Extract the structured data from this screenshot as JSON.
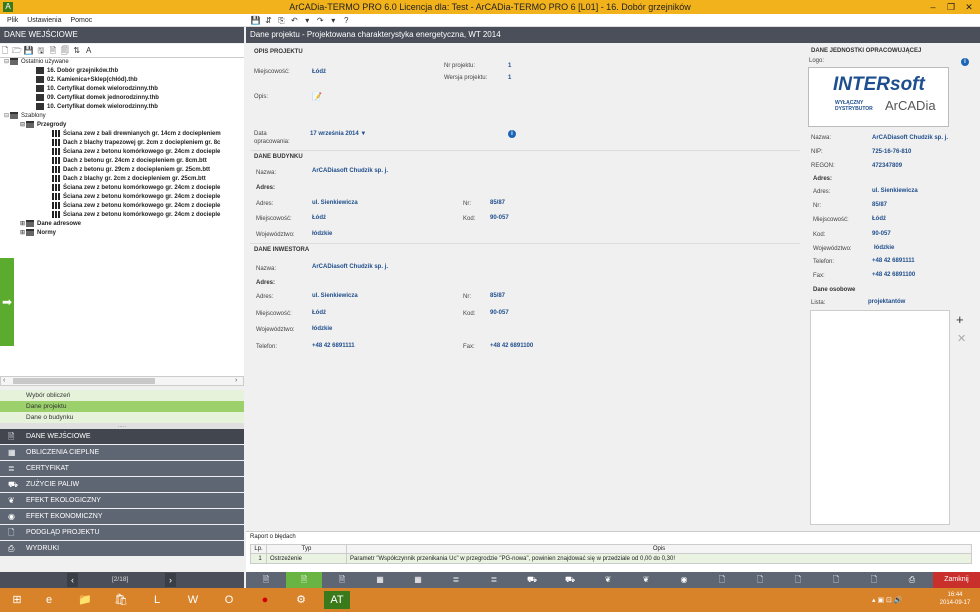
{
  "window": {
    "title": "ArCADia-TERMO PRO 6.0 Licencja dla: Test - ArCADia-TERMO PRO 6 [L01] - 16. Dobór grzejników",
    "controls": [
      "–",
      "❐",
      "✕"
    ]
  },
  "menu": [
    "Plik",
    "Ustawienia",
    "Pomoc"
  ],
  "toolbar_icons": [
    "save-icon",
    "sync-icon",
    "copy-icon",
    "undo-icon",
    "dropdown-icon",
    "redo-icon",
    "dropdown-icon",
    "help-icon"
  ],
  "toolbar_glyphs": [
    "💾",
    "⇵",
    "⎘",
    "↶",
    "▾",
    "↷",
    "▾",
    "?"
  ],
  "left_header": "DANE WEJŚCIOWE",
  "main_header": "Dane projektu - Projektowana charakterystyka energetyczna, WT 2014",
  "tree_toolbar": [
    "🗋",
    "🗁",
    "💾",
    "🖫",
    "🗎",
    "🗐",
    "⇅",
    "A"
  ],
  "tree": {
    "recent_label": "Ostatnio używane",
    "recent": [
      "16. Dobór grzejników.thb",
      "02. Kamienica+Sklep(chłód).thb",
      "10. Certyfikat domek wielorodzinny.thb",
      "09. Certyfikat domek jednorodzinny.thb",
      "10. Certyfikat domek wielorodzinny.thb"
    ],
    "templates_label": "Szablony",
    "partitions_label": "Przegrody",
    "partitions": [
      "Ściana zew z bali drewnianych gr. 14cm z dociepleniem",
      "Dach z blachy trapezowej gr. 2cm z dociepleniem gr. 8c",
      "Ściana zew z betonu komórkowego gr. 24cm z docieple",
      "Dach z betonu gr. 24cm z dociepleniem gr. 8cm.btt",
      "Dach z betonu gr. 29cm z dociepleniem gr. 25cm.btt",
      "Dach z blachy gr. 2cm z dociepleniem gr. 25cm.btt",
      "Ściana zew z betonu komórkowego gr. 24cm z docieple",
      "Ściana zew z betonu komórkowego gr. 24cm z docieple",
      "Ściana zew z betonu komórkowego gr. 24cm z docieple",
      "Ściana zew z betonu komórkowego gr. 24cm z docieple"
    ],
    "address_label": "Dane adresowe",
    "norms_label": "Normy"
  },
  "subnav": [
    "Wybór obliczeń",
    "Dane projektu",
    "Dane o budynku"
  ],
  "subnav_dots": ".....",
  "nav": [
    {
      "label": "DANE WEJŚCIOWE",
      "icon": "document-icon",
      "glyph": "🗎"
    },
    {
      "label": "OBLICZENIA CIEPLNE",
      "icon": "grid-icon",
      "glyph": "▦"
    },
    {
      "label": "CERTYFIKAT",
      "icon": "certificate-icon",
      "glyph": "≣"
    },
    {
      "label": "ZUŻYCIE PALIW",
      "icon": "truck-icon",
      "glyph": "⛟"
    },
    {
      "label": "EFEKT EKOLOGICZNY",
      "icon": "leaf-icon",
      "glyph": "❦"
    },
    {
      "label": "EFEKT EKONOMICZNY",
      "icon": "coin-icon",
      "glyph": "◉"
    },
    {
      "label": "PODGLĄD PROJEKTU",
      "icon": "preview-icon",
      "glyph": "🗋"
    },
    {
      "label": "WYDRUKI",
      "icon": "printer-icon",
      "glyph": "⎙"
    }
  ],
  "pager": {
    "prev": "‹",
    "text": "[2/18]",
    "next": "›"
  },
  "project": {
    "section": "OPIS PROJEKTU",
    "city_label": "Miejscowość:",
    "city": "Łódź",
    "nr_label": "Nr projektu:",
    "nr": "1",
    "version_label": "Wersja projektu:",
    "version": "1",
    "desc_label": "Opis:",
    "date_label_1": "Data",
    "date_label_2": "opracowania:",
    "date": "17  września  2014  ▼",
    "info": "i"
  },
  "building": {
    "section": "DANE BUDYNKU",
    "name_label": "Nazwa:",
    "name": "ArCADiasoft Chudzik sp. j.",
    "address_section": "Adres:",
    "street_label": "Adres:",
    "street": "ul. Sienkiewicza",
    "nr_label": "Nr:",
    "nr": "85/87",
    "city_label": "Miejscowość:",
    "city": "Łódź",
    "code_label": "Kod:",
    "code": "90-057",
    "region_label": "Województwo:",
    "region": "łódzkie"
  },
  "investor": {
    "section": "DANE INWESTORA",
    "name_label": "Nazwa:",
    "name": "ArCADiasoft Chudzik sp. j.",
    "address_section": "Adres:",
    "street_label": "Adres:",
    "street": "ul. Sienkiewicza",
    "nr_label": "Nr:",
    "nr": "85/87",
    "city_label": "Miejscowość:",
    "city": "Łódź",
    "code_label": "Kod:",
    "code": "90-057",
    "region_label": "Województwo:",
    "region": "łódzkie",
    "phone_label": "Telefon:",
    "phone": "+48 42 6891111",
    "fax_label": "Fax:",
    "fax": "+48 42 6891100"
  },
  "unit": {
    "section": "DANE JEDNOSTKI OPRACOWUJĄCEJ",
    "logo_label": "Logo:",
    "logo_big": "INTERsoft",
    "logo_small_1": "WYŁĄCZNY",
    "logo_small_2": "DYSTRYBUTOR",
    "logo_arc": "ArCADia",
    "name_label": "Nazwa:",
    "name": "ArCADiasoft Chudzik sp. j.",
    "nip_label": "NIP:",
    "nip": "725-16-76-810",
    "regon_label": "REGON:",
    "regon": "472347809",
    "address_section": "Adres:",
    "street_label": "Adres:",
    "street": "ul. Sienkiewicza",
    "nr_label": "Nr:",
    "nr": "85/87",
    "city_label": "Miejscowość:",
    "city": "Łódź",
    "code_label": "Kod:",
    "code": "90-057",
    "region_label": "Województwo:",
    "region": "łódzkie",
    "phone_label": "Telefon:",
    "phone": "+48 42 6891111",
    "fax_label": "Fax:",
    "fax": "+48 42 6891100",
    "person_section": "Dane osobowe",
    "list_label": "Lista:",
    "list_value": "projektantów",
    "add": "+",
    "remove": "✕"
  },
  "report": {
    "title": "Raport o błędach",
    "columns": [
      "Lp.",
      "Typ",
      "Opis"
    ],
    "rows": [
      [
        "1",
        "Ostrzeżenie",
        "Parametr \"Współczynnik przenikania Uc\" w przegrodzie \"PG-nowa\", powinien znajdować się w przedziale od 0,00 do 0,30!"
      ]
    ]
  },
  "bottom_toolbar": [
    "🗎",
    "🗎",
    "🗎",
    "▦",
    "▦",
    "≣",
    "≣",
    "⛟",
    "⛟",
    "❦",
    "❦",
    "◉",
    "🗋",
    "🗋",
    "🗋",
    "🗋",
    "🗋",
    "⎙"
  ],
  "close_button": "Zamknij",
  "taskbar": {
    "apps": [
      "⊞",
      "e",
      "📁",
      "🛍",
      "L",
      "W",
      "O",
      "●",
      "⚙",
      "AT"
    ],
    "time": "16:44",
    "date": "2014-09-17",
    "tray": "▴ ▣ ⊡ 🔊"
  },
  "colors": {
    "title": "#f2b21b",
    "header": "#4a4f5a",
    "accent_green": "#6ab443",
    "link_blue": "#1f4e8c",
    "close_red": "#c9302c"
  }
}
